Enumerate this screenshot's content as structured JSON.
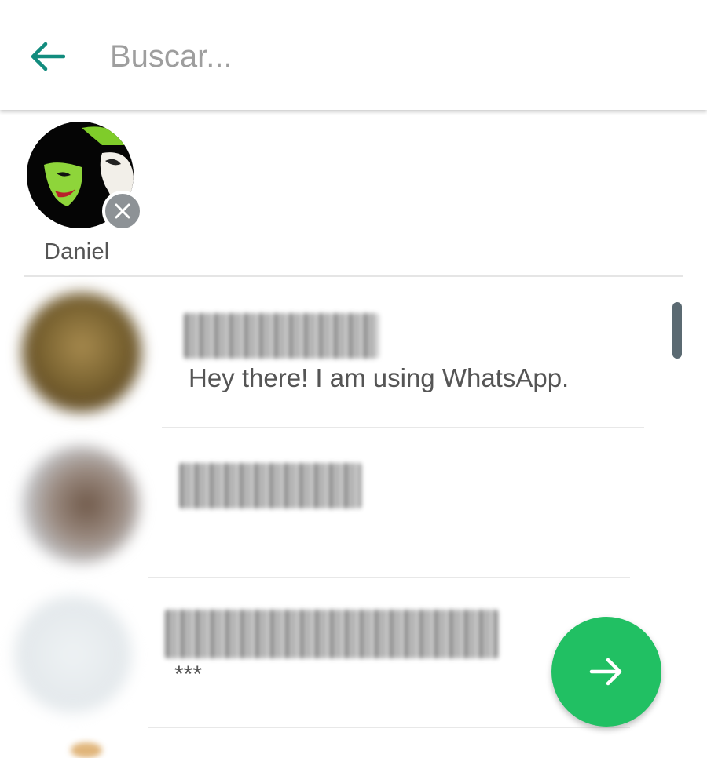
{
  "search": {
    "placeholder": "Buscar...",
    "value": ""
  },
  "icons": {
    "back": "arrow-left-icon",
    "remove": "close-icon",
    "next": "arrow-right-icon"
  },
  "colors": {
    "accent_teal": "#128C7E",
    "fab_green": "#21C063",
    "chip_remove_gray": "#8D9296",
    "scrollbar": "#5B6A72"
  },
  "selected_contacts": [
    {
      "name": "Daniel"
    }
  ],
  "contacts": [
    {
      "status": "Hey there! I am using WhatsApp."
    },
    {
      "status": ""
    },
    {
      "status": "***"
    }
  ]
}
